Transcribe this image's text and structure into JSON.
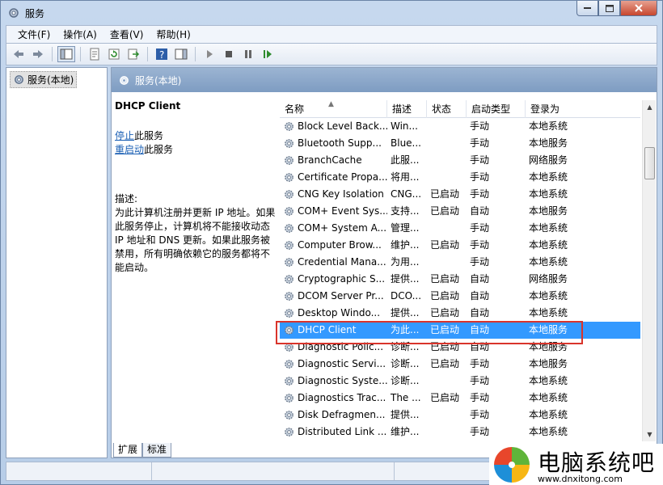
{
  "window": {
    "title": "服务"
  },
  "menu": [
    "文件(F)",
    "操作(A)",
    "查看(V)",
    "帮助(H)"
  ],
  "tree": {
    "root_label": "服务(本地)"
  },
  "detail": {
    "header_label": "服务(本地)"
  },
  "description": {
    "service_name": "DHCP Client",
    "stop_link": "停止",
    "stop_suffix": "此服务",
    "restart_link": "重启动",
    "restart_suffix": "此服务",
    "desc_label": "描述:",
    "desc_text": "为此计算机注册并更新 IP 地址。如果此服务停止，计算机将不能接收动态 IP 地址和 DNS 更新。如果此服务被禁用，所有明确依赖它的服务都将不能启动。"
  },
  "columns": [
    "名称",
    "描述",
    "状态",
    "启动类型",
    "登录为"
  ],
  "services": [
    {
      "name": "Block Level Back...",
      "desc": "Win...",
      "status": "",
      "startup": "手动",
      "logon": "本地系统"
    },
    {
      "name": "Bluetooth Supp...",
      "desc": "Blue...",
      "status": "",
      "startup": "手动",
      "logon": "本地服务"
    },
    {
      "name": "BranchCache",
      "desc": "此服...",
      "status": "",
      "startup": "手动",
      "logon": "网络服务"
    },
    {
      "name": "Certificate Propa...",
      "desc": "将用...",
      "status": "",
      "startup": "手动",
      "logon": "本地系统"
    },
    {
      "name": "CNG Key Isolation",
      "desc": "CNG...",
      "status": "已启动",
      "startup": "手动",
      "logon": "本地系统"
    },
    {
      "name": "COM+ Event Sys...",
      "desc": "支持...",
      "status": "已启动",
      "startup": "自动",
      "logon": "本地服务"
    },
    {
      "name": "COM+ System A...",
      "desc": "管理...",
      "status": "",
      "startup": "手动",
      "logon": "本地系统"
    },
    {
      "name": "Computer Brow...",
      "desc": "维护...",
      "status": "已启动",
      "startup": "手动",
      "logon": "本地系统"
    },
    {
      "name": "Credential Mana...",
      "desc": "为用...",
      "status": "",
      "startup": "手动",
      "logon": "本地系统"
    },
    {
      "name": "Cryptographic S...",
      "desc": "提供...",
      "status": "已启动",
      "startup": "自动",
      "logon": "网络服务"
    },
    {
      "name": "DCOM Server Pr...",
      "desc": "DCO...",
      "status": "已启动",
      "startup": "自动",
      "logon": "本地系统"
    },
    {
      "name": "Desktop Windo...",
      "desc": "提供...",
      "status": "已启动",
      "startup": "自动",
      "logon": "本地系统"
    },
    {
      "name": "DHCP Client",
      "desc": "为此...",
      "status": "已启动",
      "startup": "自动",
      "logon": "本地服务"
    },
    {
      "name": "Diagnostic Polic...",
      "desc": "诊断...",
      "status": "已启动",
      "startup": "自动",
      "logon": "本地服务"
    },
    {
      "name": "Diagnostic Servi...",
      "desc": "诊断...",
      "status": "已启动",
      "startup": "手动",
      "logon": "本地服务"
    },
    {
      "name": "Diagnostic Syste...",
      "desc": "诊断...",
      "status": "",
      "startup": "手动",
      "logon": "本地系统"
    },
    {
      "name": "Diagnostics Trac...",
      "desc": "The ...",
      "status": "已启动",
      "startup": "手动",
      "logon": "本地系统"
    },
    {
      "name": "Disk Defragmen...",
      "desc": "提供...",
      "status": "",
      "startup": "手动",
      "logon": "本地系统"
    },
    {
      "name": "Distributed Link ...",
      "desc": "维护...",
      "status": "",
      "startup": "手动",
      "logon": "本地系统"
    }
  ],
  "tabs": [
    "扩展",
    "标准"
  ],
  "watermark": {
    "name": "电脑系统吧",
    "url": "www.dnxitong.com"
  },
  "colors": {
    "selection": "#3399ff",
    "highlight_box": "#d9342b",
    "link": "#1a5fb4"
  }
}
